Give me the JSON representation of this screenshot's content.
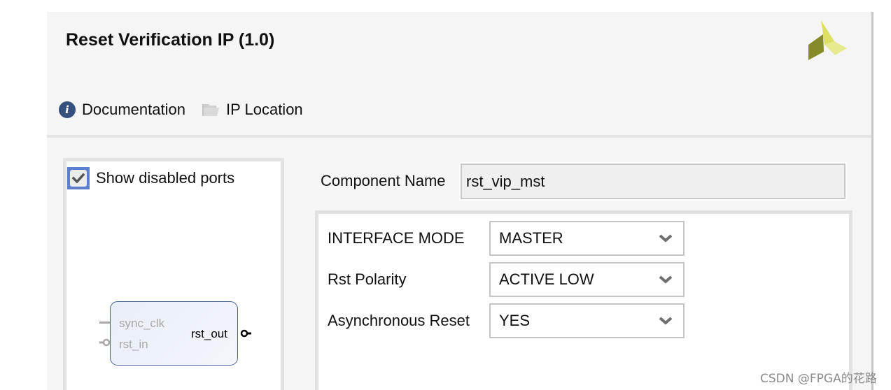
{
  "header": {
    "title": "Reset Verification IP (1.0)",
    "logo": "xilinx-logo-icon",
    "links": [
      {
        "label": "Documentation",
        "icon": "info-icon"
      },
      {
        "label": "IP Location",
        "icon": "folder-icon"
      }
    ]
  },
  "port_panel": {
    "show_disabled_ports": {
      "label": "Show disabled ports",
      "checked": true
    },
    "block": {
      "inputs": [
        {
          "name": "sync_clk",
          "enabled": false
        },
        {
          "name": "rst_in",
          "enabled": false
        }
      ],
      "outputs": [
        {
          "name": "rst_out",
          "enabled": true
        }
      ]
    }
  },
  "component": {
    "label": "Component Name",
    "value": "rst_vip_mst"
  },
  "params": [
    {
      "label": "INTERFACE MODE",
      "value": "MASTER"
    },
    {
      "label": "Rst Polarity",
      "value": "ACTIVE LOW"
    },
    {
      "label": "Asynchronous Reset",
      "value": "YES"
    }
  ],
  "colors": {
    "accent": "#5b7fcf",
    "info_icon": "#35507f",
    "block_border": "#4a5f93",
    "logo_light": "#dde063",
    "logo_pale": "#e6ea8f",
    "logo_dark": "#858a2a"
  },
  "watermark": "CSDN @FPGA的花路"
}
